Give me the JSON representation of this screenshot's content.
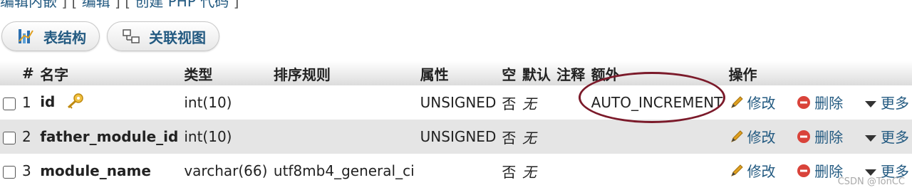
{
  "top_links": {
    "edit_inline": "编辑内嵌",
    "edit": "编辑",
    "create_php": "创建 PHP 代码"
  },
  "tabs": [
    {
      "label": "表结构",
      "icon": "table-structure-icon"
    },
    {
      "label": "关联视图",
      "icon": "relation-view-icon"
    }
  ],
  "columns": [
    "#",
    "名字",
    "类型",
    "排序规则",
    "属性",
    "空",
    "默认",
    "注释",
    "额外",
    "操作"
  ],
  "rows": [
    {
      "num": "1",
      "name": "id",
      "key_icon": "key-icon",
      "type": "int(10)",
      "collation": "",
      "attributes": "UNSIGNED",
      "null": "否",
      "default": "无",
      "comment": "",
      "extra": "AUTO_INCREMENT"
    },
    {
      "num": "2",
      "name": "father_module_id",
      "type": "int(10)",
      "collation": "",
      "attributes": "UNSIGNED",
      "null": "否",
      "default": "无",
      "comment": "",
      "extra": ""
    },
    {
      "num": "3",
      "name": "module_name",
      "type": "varchar(66)",
      "collation": "utf8mb4_general_ci",
      "attributes": "",
      "null": "否",
      "default": "无",
      "comment": "",
      "extra": ""
    }
  ],
  "actions": {
    "edit": "修改",
    "delete": "删除",
    "more": "更多"
  },
  "watermark": "CSDN @TonCC",
  "colors": {
    "link": "#235a81",
    "annotation": "#7b1a2a",
    "row_alt": "#e5e5e5",
    "delete_icon": "#d9433a",
    "pencil_icon": "#e0a020"
  }
}
